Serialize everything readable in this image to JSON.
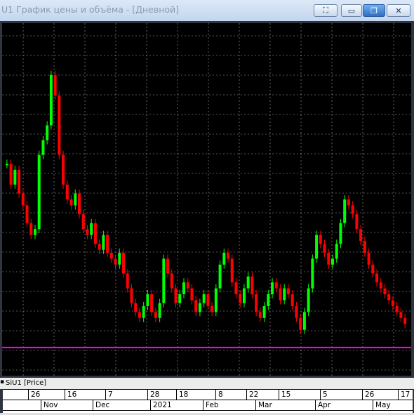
{
  "window": {
    "title": "U1 График цены и объёма - [Дневной]"
  },
  "titlebar_buttons": [
    {
      "name": "tools-button",
      "glyph": "⛶"
    },
    {
      "name": "minimize-button",
      "glyph": "▭"
    },
    {
      "name": "maximize-button",
      "glyph": "❐"
    },
    {
      "name": "close-button",
      "glyph": "✕"
    }
  ],
  "status": {
    "instrument_label": "SiU1 [Price]"
  },
  "axis": {
    "day_ticks": [
      "26",
      "16",
      "7",
      "28",
      "18",
      "8",
      "22",
      "15",
      "5",
      "26",
      "17"
    ],
    "month_ticks": [
      "Nov",
      "Dec",
      "2021",
      "Feb",
      "Mar",
      "Apr",
      "May"
    ]
  },
  "colors": {
    "up": "#00ff00",
    "down": "#ff0000",
    "background": "#000000",
    "grid": "#ffffff",
    "level": "#ff00ff"
  },
  "chart_data": {
    "type": "candlestick",
    "grid": true,
    "horizontal_line": {
      "relative_level": 0.92,
      "color": "#ff00ff"
    },
    "series": [
      {
        "name": "SiU1 [Price]",
        "relative_close": [
          0.62,
          0.55,
          0.6,
          0.52,
          0.48,
          0.42,
          0.38,
          0.4,
          0.65,
          0.7,
          0.75,
          0.92,
          0.85,
          0.65,
          0.55,
          0.5,
          0.48,
          0.52,
          0.45,
          0.4,
          0.38,
          0.42,
          0.35,
          0.33,
          0.38,
          0.32,
          0.3,
          0.28,
          0.32,
          0.25,
          0.2,
          0.15,
          0.12,
          0.1,
          0.14,
          0.18,
          0.12,
          0.1,
          0.15,
          0.3,
          0.25,
          0.2,
          0.15,
          0.18,
          0.22,
          0.2,
          0.16,
          0.12,
          0.15,
          0.18,
          0.14,
          0.12,
          0.2,
          0.28,
          0.32,
          0.3,
          0.22,
          0.18,
          0.15,
          0.2,
          0.24,
          0.18,
          0.12,
          0.1,
          0.14,
          0.18,
          0.22,
          0.2,
          0.16,
          0.2,
          0.18,
          0.14,
          0.1,
          0.06,
          0.12,
          0.2,
          0.3,
          0.38,
          0.35,
          0.32,
          0.28,
          0.3,
          0.35,
          0.42,
          0.5,
          0.48,
          0.45,
          0.4,
          0.36,
          0.32,
          0.28,
          0.25,
          0.22,
          0.2,
          0.18,
          0.16,
          0.14,
          0.12,
          0.1,
          0.08
        ]
      }
    ]
  }
}
